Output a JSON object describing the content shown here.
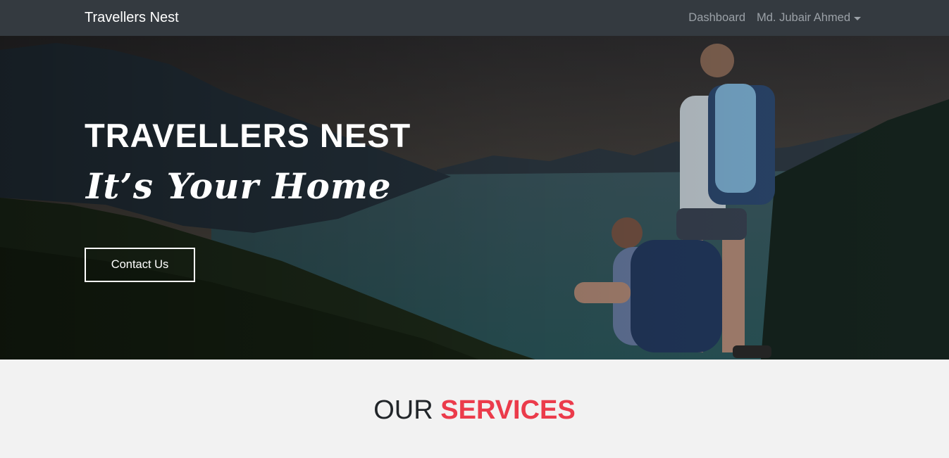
{
  "navbar": {
    "brand": "Travellers Nest",
    "links": {
      "dashboard": "Dashboard",
      "user": "Md. Jubair Ahmed"
    }
  },
  "hero": {
    "title": "TRAVELLERS NEST",
    "subtitle": "It’s Your Home",
    "contact_button": "Contact Us"
  },
  "services": {
    "heading_light": "OUR",
    "heading_accent": "SERVICES"
  },
  "colors": {
    "navbar_bg": "#343a40",
    "accent": "#eb3b4b",
    "section_bg": "#f2f2f2"
  },
  "icons": {
    "user_menu": "caret-down-icon"
  }
}
